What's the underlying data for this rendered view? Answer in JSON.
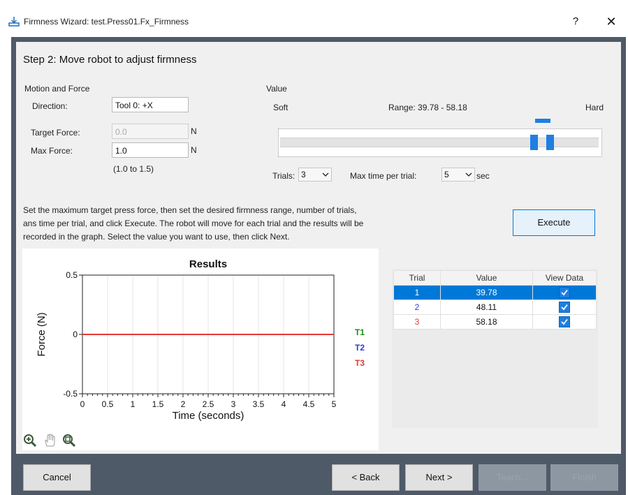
{
  "window": {
    "title": "Firmness Wizard: test.Press01.Fx_Firmness",
    "help_label": "?",
    "close_label": "✕"
  },
  "step_title": "Step 2: Move robot to adjust firmness",
  "motion": {
    "section_label": "Motion and Force",
    "direction_label": "Direction:",
    "direction_value": "Tool 0: +X",
    "target_force_label": "Target Force:",
    "target_force_value": "0.0",
    "target_force_unit": "N",
    "max_force_label": "Max Force:",
    "max_force_value": "1.0",
    "max_force_unit": "N",
    "max_force_range": "(1.0 to 1.5)"
  },
  "value": {
    "section_label": "Value",
    "soft_label": "Soft",
    "hard_label": "Hard",
    "range_label": "Range: 39.78 - 58.18",
    "trials_label": "Trials:",
    "trials_value": "3",
    "max_time_label": "Max time per trial:",
    "max_time_value": "5",
    "max_time_unit": "sec"
  },
  "instructions": [
    "Set the maximum target press force, then set the desired firmness range, number of trials,",
    "ans time per trial, and click Execute.  The robot will move for each trial and the results will be",
    "recorded in the graph.  Select the value you want to use, then click Next."
  ],
  "execute_label": "Execute",
  "chart_data": {
    "type": "line",
    "title": "Results",
    "xlabel": "Time (seconds)",
    "ylabel": "Force (N)",
    "xlim": [
      0,
      5
    ],
    "ylim": [
      -0.5,
      0.5
    ],
    "xticks": [
      "0",
      "0.5",
      "1",
      "1.5",
      "2",
      "2.5",
      "3",
      "3.5",
      "4",
      "4.5",
      "5"
    ],
    "yticks": [
      "0.5",
      "0",
      "-0.5"
    ],
    "series": [
      {
        "name": "T1",
        "color": "#1a8a1a",
        "x": [
          0,
          5
        ],
        "y": [
          0,
          0
        ]
      },
      {
        "name": "T2",
        "color": "#2a3de0",
        "x": [
          0,
          5
        ],
        "y": [
          0,
          0
        ]
      },
      {
        "name": "T3",
        "color": "#e53935",
        "x": [
          0,
          5
        ],
        "y": [
          0,
          0
        ]
      }
    ]
  },
  "chart_tools": [
    "zoom-in-icon",
    "pan-hand-icon",
    "zoom-reset-icon"
  ],
  "table": {
    "headers": [
      "Trial",
      "Value",
      "View Data"
    ],
    "rows": [
      {
        "trial": "1",
        "value": "39.78",
        "checked": true,
        "color": "#ffffff"
      },
      {
        "trial": "2",
        "value": "48.11",
        "checked": true,
        "color": "#2a3de0"
      },
      {
        "trial": "3",
        "value": "58.18",
        "checked": true,
        "color": "#e53935"
      }
    ]
  },
  "buttons": {
    "cancel": "Cancel",
    "back": "< Back",
    "next": "Next >",
    "teach": "Teach...",
    "finish": "Finish"
  },
  "colors": {
    "accent": "#0078d7",
    "frame": "#4e5a67",
    "panel": "#f0f0f0",
    "slider_thumb": "#1e7fe0"
  }
}
